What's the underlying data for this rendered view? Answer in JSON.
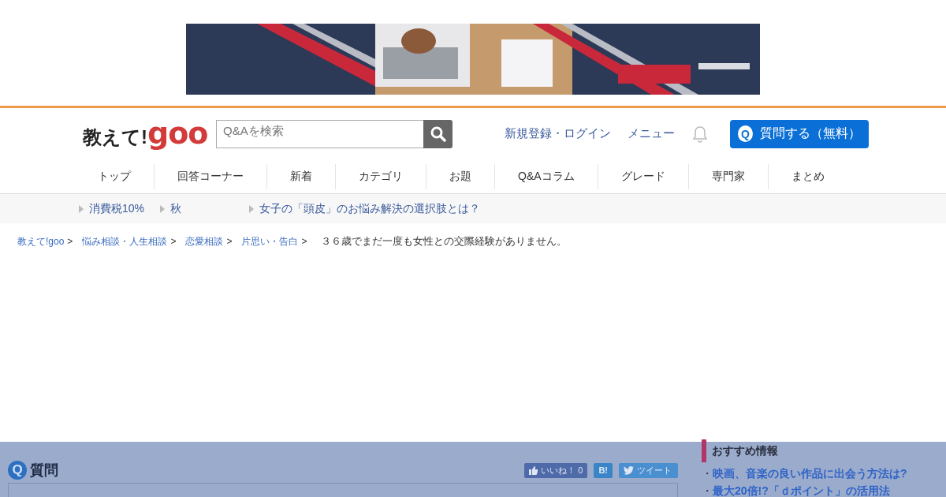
{
  "header": {
    "logo": {
      "part_1": "教えて!",
      "part_2": "goo"
    },
    "search": {
      "placeholder": "Q&Aを検索"
    },
    "links": [
      "新規登録・ログイン",
      "メニュー"
    ],
    "ask_button": {
      "icon": "Q",
      "label": "質問する（無料）"
    }
  },
  "nav": [
    {
      "label": "トップ",
      "selected": false
    },
    {
      "label": "回答コーナー",
      "selected": false
    },
    {
      "label": "新着",
      "selected": false
    },
    {
      "label": "カテゴリ",
      "selected": false
    },
    {
      "label": "お題",
      "selected": false
    },
    {
      "label": "Q&Aコラム",
      "selected": false
    },
    {
      "label": "グレード",
      "selected": false
    },
    {
      "label": "専門家",
      "selected": false
    },
    {
      "label": "まとめ",
      "selected": false
    }
  ],
  "trending": [
    "消費税10%",
    "秋",
    "女子の「頭皮」のお悩み解決の選択肢とは？"
  ],
  "breadcrumb": [
    {
      "label": "教えて!goo",
      "link": true
    },
    {
      "label": "悩み相談・人生相談",
      "link": true
    },
    {
      "label": "恋愛相談",
      "link": true
    },
    {
      "label": "片思い・告白",
      "link": true
    },
    {
      "label": "３６歳でまだ一度も女性との交際経験がありません。",
      "link": false
    }
  ],
  "separator": ">",
  "question": {
    "icon": "Q",
    "title": "質問",
    "like_button": "いいね！ 0",
    "hatena_button": "B!",
    "tweet_button": "ツイート"
  },
  "recommended": {
    "title": "おすすめ情報",
    "bullet": "・",
    "items": [
      "映画、音楽の良い作品に出会う方法は?",
      "最大20倍!?「ｄポイント」の活用法"
    ]
  }
}
